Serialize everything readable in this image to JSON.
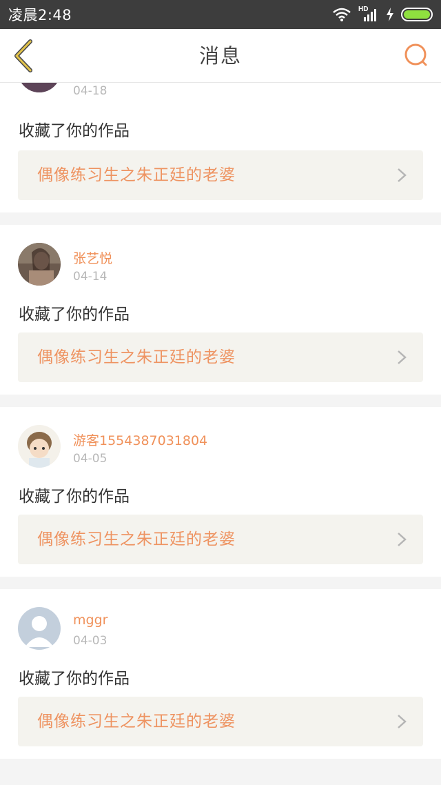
{
  "status_bar": {
    "time": "凌晨2:48",
    "network": "HD"
  },
  "nav": {
    "title": "消息"
  },
  "messages": [
    {
      "name": "",
      "date": "04-18",
      "action": "收藏了你的作品",
      "work": "偶像练习生之朱正廷的老婆"
    },
    {
      "name": "张艺悦",
      "date": "04-14",
      "action": "收藏了你的作品",
      "work": "偶像练习生之朱正廷的老婆"
    },
    {
      "name": "游客1554387031804",
      "date": "04-05",
      "action": "收藏了你的作品",
      "work": "偶像练习生之朱正廷的老婆"
    },
    {
      "name": "mggr",
      "date": "04-03",
      "action": "收藏了你的作品",
      "work": "偶像练习生之朱正廷的老婆"
    }
  ],
  "colors": {
    "accent": "#f0915a",
    "back_arrow": "#e2c34a",
    "work_bg": "#f4f3ee"
  }
}
